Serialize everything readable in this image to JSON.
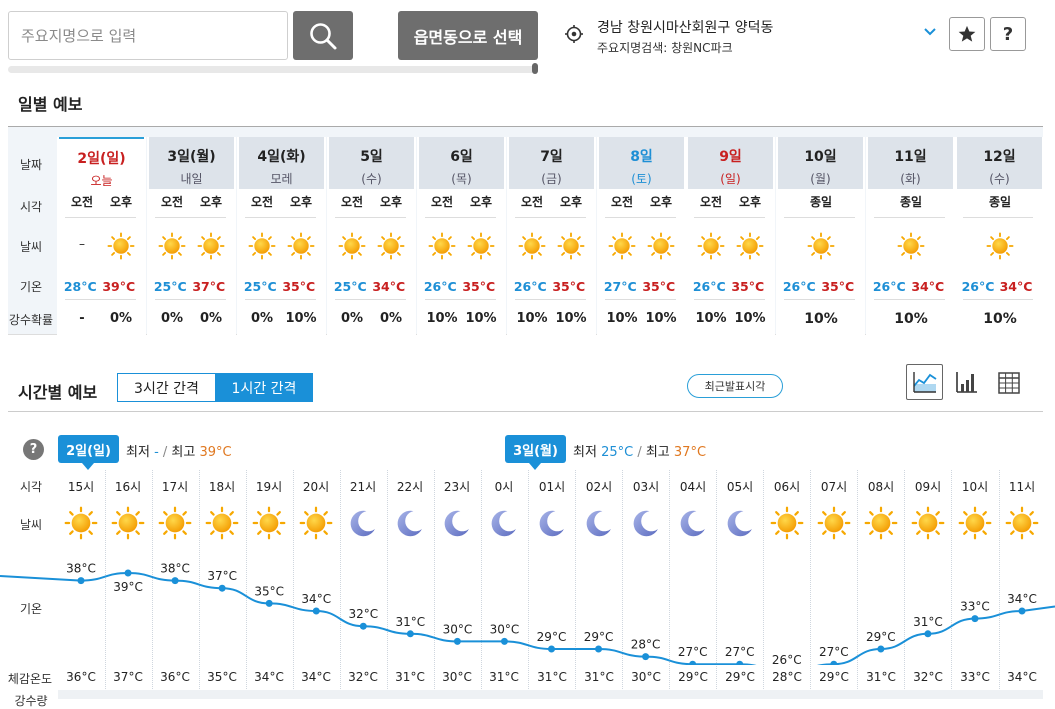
{
  "search": {
    "placeholder": "주요지명으로 입력",
    "select_label": "읍면동으로 선택"
  },
  "location": {
    "main": "경남 창원시마산회원구 양덕동",
    "sub": "주요지명검색: 창원NC파크"
  },
  "daily": {
    "title": "일별 예보",
    "row_labels": [
      "날짜",
      "시각",
      "날씨",
      "기온",
      "강수확률"
    ],
    "days": [
      {
        "date": "2일(일)",
        "sub": "오늘",
        "color": "#c82020",
        "split": true,
        "times": [
          "오전",
          "오후"
        ],
        "weather": [
          "–",
          "sun"
        ],
        "low": "28°C",
        "high": "39°C",
        "pop": [
          "-",
          "0%"
        ]
      },
      {
        "date": "3일(월)",
        "sub": "내일",
        "color": "#222222",
        "split": true,
        "times": [
          "오전",
          "오후"
        ],
        "weather": [
          "sun",
          "sun"
        ],
        "low": "25°C",
        "high": "37°C",
        "pop": [
          "0%",
          "0%"
        ]
      },
      {
        "date": "4일(화)",
        "sub": "모레",
        "color": "#222222",
        "split": true,
        "times": [
          "오전",
          "오후"
        ],
        "weather": [
          "sun",
          "sun"
        ],
        "low": "25°C",
        "high": "35°C",
        "pop": [
          "0%",
          "10%"
        ]
      },
      {
        "date": "5일",
        "sub": "(수)",
        "color": "#222222",
        "split": true,
        "times": [
          "오전",
          "오후"
        ],
        "weather": [
          "sun",
          "sun"
        ],
        "low": "25°C",
        "high": "34°C",
        "pop": [
          "0%",
          "0%"
        ]
      },
      {
        "date": "6일",
        "sub": "(목)",
        "color": "#222222",
        "split": true,
        "times": [
          "오전",
          "오후"
        ],
        "weather": [
          "sun",
          "sun"
        ],
        "low": "26°C",
        "high": "35°C",
        "pop": [
          "10%",
          "10%"
        ]
      },
      {
        "date": "7일",
        "sub": "(금)",
        "color": "#222222",
        "split": true,
        "times": [
          "오전",
          "오후"
        ],
        "weather": [
          "sun",
          "sun"
        ],
        "low": "26°C",
        "high": "35°C",
        "pop": [
          "10%",
          "10%"
        ]
      },
      {
        "date": "8일",
        "sub": "(토)",
        "color": "#1e8fd5",
        "split": true,
        "times": [
          "오전",
          "오후"
        ],
        "weather": [
          "sun",
          "sun"
        ],
        "low": "27°C",
        "high": "35°C",
        "pop": [
          "10%",
          "10%"
        ]
      },
      {
        "date": "9일",
        "sub": "(일)",
        "color": "#c82020",
        "split": true,
        "times": [
          "오전",
          "오후"
        ],
        "weather": [
          "sun",
          "sun"
        ],
        "low": "26°C",
        "high": "35°C",
        "pop": [
          "10%",
          "10%"
        ]
      },
      {
        "date": "10일",
        "sub": "(월)",
        "color": "#222222",
        "split": false,
        "times": [
          "종일"
        ],
        "weather": [
          "sun"
        ],
        "low": "26°C",
        "high": "35°C",
        "pop": [
          "10%"
        ]
      },
      {
        "date": "11일",
        "sub": "(화)",
        "color": "#222222",
        "split": false,
        "times": [
          "종일"
        ],
        "weather": [
          "sun"
        ],
        "low": "26°C",
        "high": "34°C",
        "pop": [
          "10%"
        ]
      },
      {
        "date": "12일",
        "sub": "(수)",
        "color": "#222222",
        "split": false,
        "times": [
          "종일"
        ],
        "weather": [
          "sun"
        ],
        "low": "26°C",
        "high": "34°C",
        "pop": [
          "10%"
        ]
      }
    ]
  },
  "hourly": {
    "title": "시간별 예보",
    "tabs": [
      "3시간 간격",
      "1시간 간격"
    ],
    "active_tab": 1,
    "latest_label": "최근발표시각",
    "help": "?",
    "row_labels": [
      "시각",
      "날씨",
      "기온",
      "체감온도",
      "강수량"
    ],
    "day_tags": [
      {
        "tag": "2일(일)",
        "min_label": "최저",
        "min": "-",
        "max_label": "최고",
        "max": "39°C"
      },
      {
        "tag": "3일(월)",
        "min_label": "최저",
        "min": "25°C",
        "max_label": "최고",
        "max": "37°C"
      }
    ],
    "hours": [
      "15시",
      "16시",
      "17시",
      "18시",
      "19시",
      "20시",
      "21시",
      "22시",
      "23시",
      "0시",
      "01시",
      "02시",
      "03시",
      "04시",
      "05시",
      "06시",
      "07시",
      "08시",
      "09시",
      "10시",
      "11시"
    ],
    "weather": [
      "sun",
      "sun",
      "sun",
      "sun",
      "sun",
      "sun",
      "moon",
      "moon",
      "moon",
      "moon",
      "moon",
      "moon",
      "moon",
      "moon",
      "moon",
      "sun",
      "sun",
      "sun",
      "sun",
      "sun",
      "sun"
    ],
    "feels": [
      "36°C",
      "37°C",
      "36°C",
      "35°C",
      "34°C",
      "34°C",
      "32°C",
      "31°C",
      "30°C",
      "31°C",
      "31°C",
      "31°C",
      "30°C",
      "29°C",
      "29°C",
      "28°C",
      "29°C",
      "31°C",
      "32°C",
      "33°C",
      "34°C"
    ]
  },
  "chart_data": {
    "type": "line",
    "x": [
      "15시",
      "16시",
      "17시",
      "18시",
      "19시",
      "20시",
      "21시",
      "22시",
      "23시",
      "0시",
      "01시",
      "02시",
      "03시",
      "04시",
      "05시",
      "06시",
      "07시",
      "08시",
      "09시",
      "10시",
      "11시"
    ],
    "values": [
      38,
      39,
      38,
      37,
      35,
      34,
      32,
      31,
      30,
      30,
      29,
      29,
      28,
      27,
      27,
      26,
      27,
      29,
      31,
      33,
      34
    ],
    "labels": [
      "38°C",
      "39°C",
      "38°C",
      "37°C",
      "35°C",
      "34°C",
      "32°C",
      "31°C",
      "30°C",
      "30°C",
      "29°C",
      "29°C",
      "28°C",
      "27°C",
      "27°C",
      "26°C",
      "27°C",
      "29°C",
      "31°C",
      "33°C",
      "34°C"
    ],
    "ylabel": "기온",
    "line_color": "#1a90d8"
  },
  "colors": {
    "accent": "#1a90d8",
    "hot": "#c82020",
    "cold": "#1e8fd5",
    "max_orange": "#e07820"
  }
}
